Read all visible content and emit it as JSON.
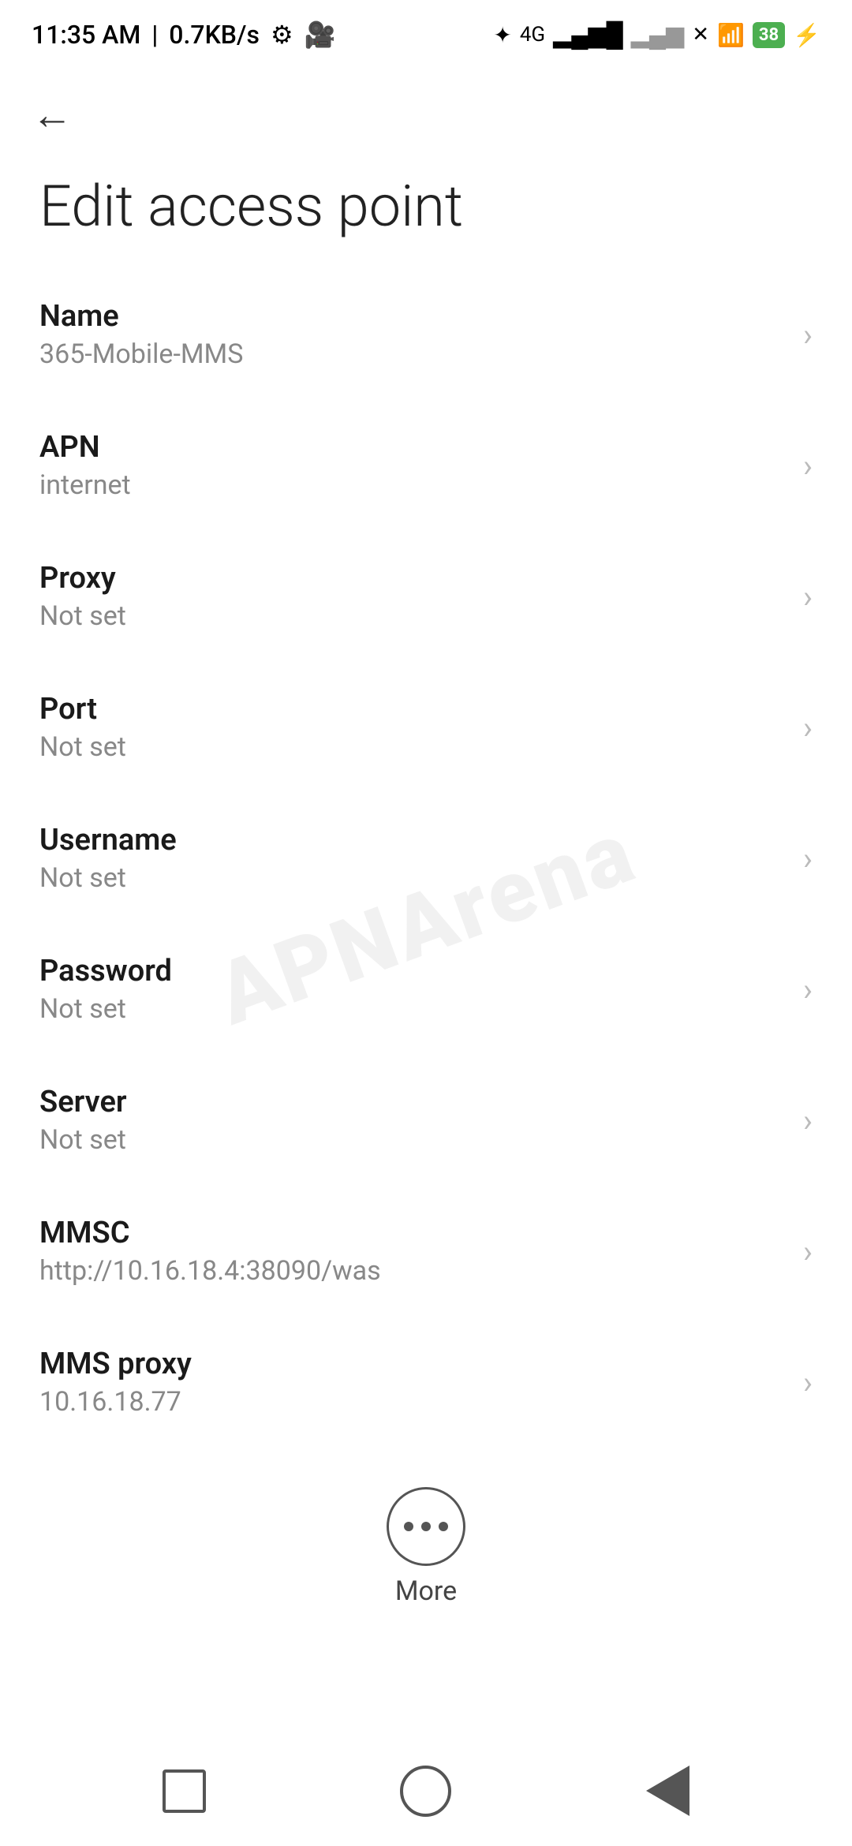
{
  "statusBar": {
    "time": "11:35 AM",
    "speed": "0.7KB/s",
    "battery": "38"
  },
  "toolbar": {
    "backLabel": "←"
  },
  "page": {
    "title": "Edit access point"
  },
  "settings": [
    {
      "label": "Name",
      "value": "365-Mobile-MMS"
    },
    {
      "label": "APN",
      "value": "internet"
    },
    {
      "label": "Proxy",
      "value": "Not set"
    },
    {
      "label": "Port",
      "value": "Not set"
    },
    {
      "label": "Username",
      "value": "Not set"
    },
    {
      "label": "Password",
      "value": "Not set"
    },
    {
      "label": "Server",
      "value": "Not set"
    },
    {
      "label": "MMSC",
      "value": "http://10.16.18.4:38090/was"
    },
    {
      "label": "MMS proxy",
      "value": "10.16.18.77"
    }
  ],
  "more": {
    "label": "More"
  },
  "watermark": "APNArena"
}
